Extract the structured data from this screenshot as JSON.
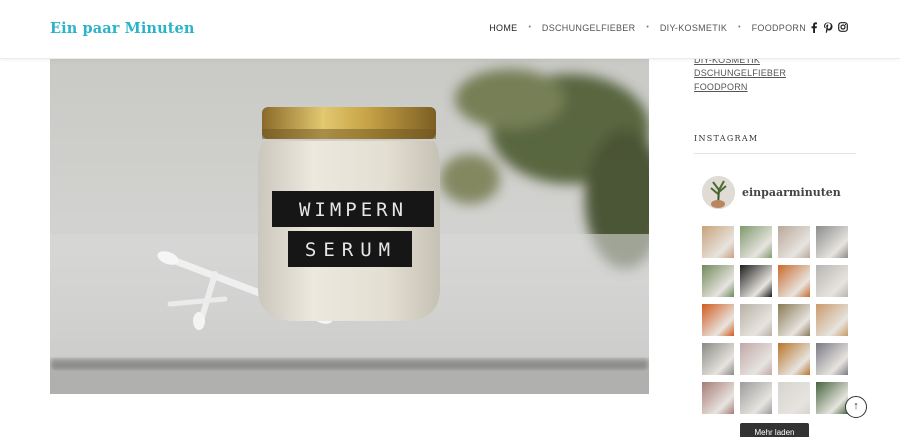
{
  "site": {
    "logo": "Ein paar Minuten"
  },
  "nav": {
    "items": [
      "HOME",
      "DSCHUNGELFIEBER",
      "DIY-KOSMETIK",
      "FOODPORN"
    ],
    "separator": "•",
    "social_icons": [
      "facebook-icon",
      "pinterest-icon",
      "instagram-icon"
    ]
  },
  "hero": {
    "jar_label_line1": "WIMPERN",
    "jar_label_line2": "SERUM"
  },
  "sidebar": {
    "categories": [
      "DIY-KOSMETIK",
      "DSCHUNGELFIEBER",
      "FOODPORN"
    ],
    "widget_title": "INSTAGRAM",
    "instagram_user": "einpaarminuten",
    "more_button": "Mehr laden",
    "thumb_colors": [
      [
        "#c8a27a",
        "#7e9a6c",
        "#b9a89a",
        "#8c8c8c"
      ],
      [
        "#6f8a5a",
        "#1e1e1e",
        "#c96a2c",
        "#b7b5b2"
      ],
      [
        "#d25a1c",
        "#b8b0a6",
        "#8a7a56",
        "#c89a6a"
      ],
      [
        "#8a8a82",
        "#c0a8a8",
        "#b8742c",
        "#7a7a84"
      ],
      [
        "#a87b77",
        "#9c9c9c",
        "#d6d4d0",
        "#46643e"
      ]
    ]
  },
  "back_to_top": "↑",
  "colors": {
    "accent": "#2bb3c6",
    "button": "#333333"
  }
}
